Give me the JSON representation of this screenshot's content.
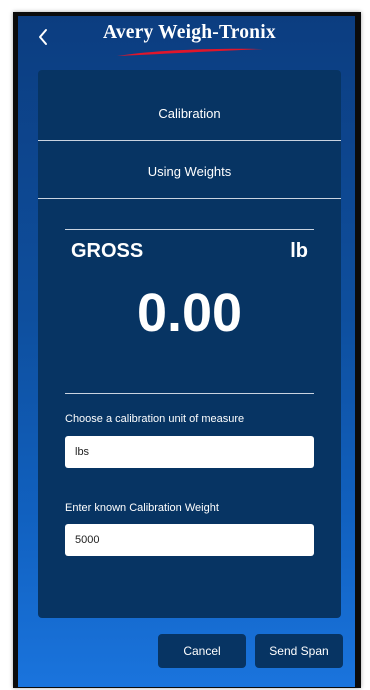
{
  "header": {
    "back_icon": "chevron-left-icon",
    "logo_text": "Avery Weigh-Tronix",
    "logo_swoosh_color": "#e0162b"
  },
  "panel": {
    "title": "Calibration",
    "subtitle": "Using Weights"
  },
  "display": {
    "mode": "GROSS",
    "unit": "lb",
    "value": "0.00"
  },
  "form": {
    "unit_label": "Choose a calibration unit of measure",
    "unit_value": "lbs",
    "weight_label": "Enter known Calibration Weight",
    "weight_value": "5000"
  },
  "actions": {
    "cancel_label": "Cancel",
    "send_span_label": "Send Span"
  },
  "colors": {
    "panel": "#073463",
    "background_top": "#0c3d80",
    "background_bottom": "#1a74dd"
  }
}
